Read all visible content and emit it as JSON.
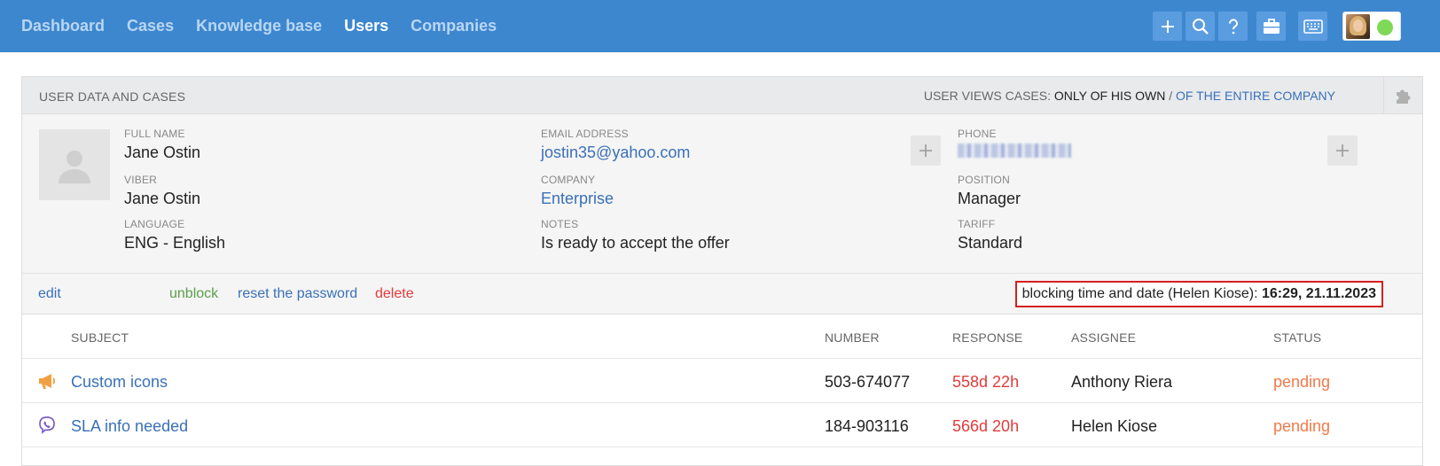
{
  "nav": {
    "items": [
      {
        "label": "Dashboard",
        "active": false
      },
      {
        "label": "Cases",
        "active": false
      },
      {
        "label": "Knowledge base",
        "active": false
      },
      {
        "label": "Users",
        "active": true
      },
      {
        "label": "Companies",
        "active": false
      }
    ]
  },
  "toolbar": {
    "icons": [
      "plus-icon",
      "search-icon",
      "help-icon",
      "briefcase-icon",
      "keyboard-icon"
    ],
    "status_color": "#7ed957"
  },
  "panel": {
    "title": "USER DATA AND CASES",
    "views_label": "USER VIEWS CASES: ",
    "views_own": "ONLY OF HIS OWN",
    "views_sep": " / ",
    "views_company": "OF THE ENTIRE COMPANY"
  },
  "user": {
    "full_name_label": "FULL NAME",
    "full_name": "Jane Ostin",
    "viber_label": "VIBER",
    "viber": "Jane Ostin",
    "language_label": "LANGUAGE",
    "language": "ENG - English",
    "email_label": "EMAIL ADDRESS",
    "email": "jostin35@yahoo.com",
    "company_label": "COMPANY",
    "company": "Enterprise",
    "notes_label": "NOTES",
    "notes": "Is ready to accept the offer",
    "phone_label": "PHONE",
    "position_label": "POSITION",
    "position": "Manager",
    "tariff_label": "TARIFF",
    "tariff": "Standard"
  },
  "actions": {
    "edit": "edit",
    "unblock": "unblock",
    "reset": "reset the password",
    "delete": "delete",
    "block_label": "blocking time and date (Helen Kiose): ",
    "block_value": "16:29, 21.11.2023"
  },
  "table": {
    "headers": {
      "subject": "SUBJECT",
      "number": "NUMBER",
      "response": "RESPONSE",
      "assignee": "ASSIGNEE",
      "status": "STATUS"
    },
    "rows": [
      {
        "icon": "megaphone-icon",
        "subject": "Custom icons",
        "number": "503-674077",
        "response": "558d 22h",
        "assignee": "Anthony Riera",
        "status": "pending"
      },
      {
        "icon": "viber-icon",
        "subject": "SLA info needed",
        "number": "184-903116",
        "response": "566d 20h",
        "assignee": "Helen Kiose",
        "status": "pending"
      }
    ]
  },
  "colors": {
    "topbar": "#3d87cf",
    "link": "#3a70b8",
    "danger": "#e23b3b",
    "success": "#5a9e4a",
    "pending": "#f07a4a"
  }
}
